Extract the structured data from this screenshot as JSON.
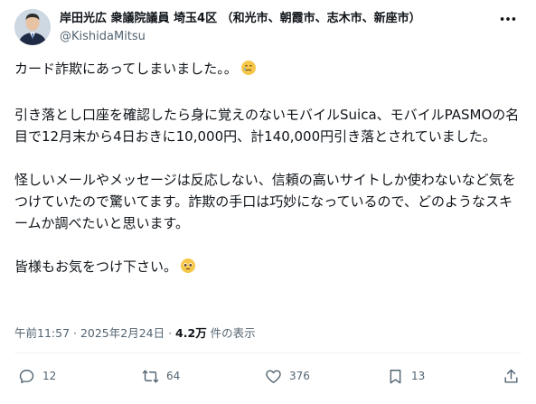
{
  "author": {
    "name": "岸田光広 衆議院議員 埼玉4区 （和光市、朝霞市、志木市、新座市）",
    "handle": "@KishidaMitsu",
    "avatar_icon": "avatar-photo"
  },
  "post": {
    "line1": "カード詐欺にあってしまいました。。",
    "para2": "引き落とし口座を確認したら身に覚えのないモバイルSuica、モバイルPASMOの名目で12月末から4日おきに10,000円、計140,000円引き落とされていました。",
    "para3": "怪しいメールやメッセージは反応しない、信頼の高いサイトしか使わないなど気をつけていたので驚いてます。詐欺の手口は巧妙になっているので、どのようなスキームか調べたいと思います。",
    "line4": "皆様もお気をつけ下さい。",
    "emoji1": "face-holding-back-tears-icon",
    "emoji2": "pleading-face-icon"
  },
  "meta": {
    "time": "午前11:57",
    "sep": " · ",
    "date": "2025年2月24日",
    "views_count": "4.2万",
    "views_label": " 件の表示"
  },
  "actions": {
    "replies": "12",
    "reposts": "64",
    "likes": "376",
    "bookmarks": "13"
  },
  "colors": {
    "text": "#0f1419",
    "secondary": "#536471",
    "divider": "#eff3f4"
  }
}
